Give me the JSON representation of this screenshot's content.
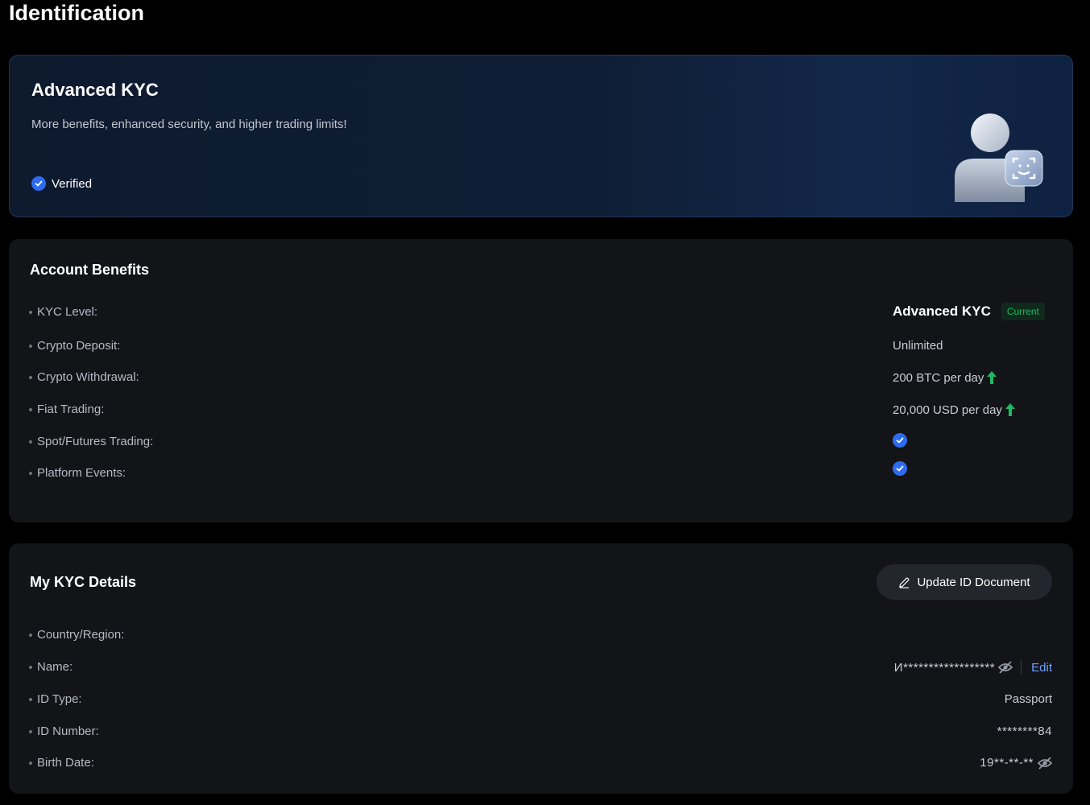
{
  "page": {
    "title": "Identification"
  },
  "hero": {
    "title": "Advanced KYC",
    "subtitle": "More benefits, enhanced security, and higher trading limits!",
    "status": "Verified"
  },
  "benefits": {
    "title": "Account Benefits",
    "kyc_level_label": "KYC Level:",
    "kyc_level_value": "Advanced KYC",
    "current_badge": "Current",
    "crypto_deposit_label": "Crypto Deposit:",
    "crypto_deposit_value": "Unlimited",
    "crypto_withdrawal_label": "Crypto Withdrawal:",
    "crypto_withdrawal_value": "200 BTC per day",
    "fiat_trading_label": "Fiat Trading:",
    "fiat_trading_value": "20,000 USD per day",
    "spot_futures_label": "Spot/Futures Trading:",
    "platform_events_label": "Platform Events:"
  },
  "kyc_details": {
    "title": "My KYC Details",
    "update_button": "Update ID Document",
    "country_label": "Country/Region:",
    "name_label": "Name:",
    "name_value": "И******************",
    "edit_label": "Edit",
    "id_type_label": "ID Type:",
    "id_type_value": "Passport",
    "id_number_label": "ID Number:",
    "id_number_value": "********84",
    "birth_date_label": "Birth Date:",
    "birth_date_value": "19**-**-**"
  },
  "colors": {
    "accent_blue": "#2d6cf0",
    "up_green": "#1fb863",
    "link_blue": "#6ea1ff"
  }
}
